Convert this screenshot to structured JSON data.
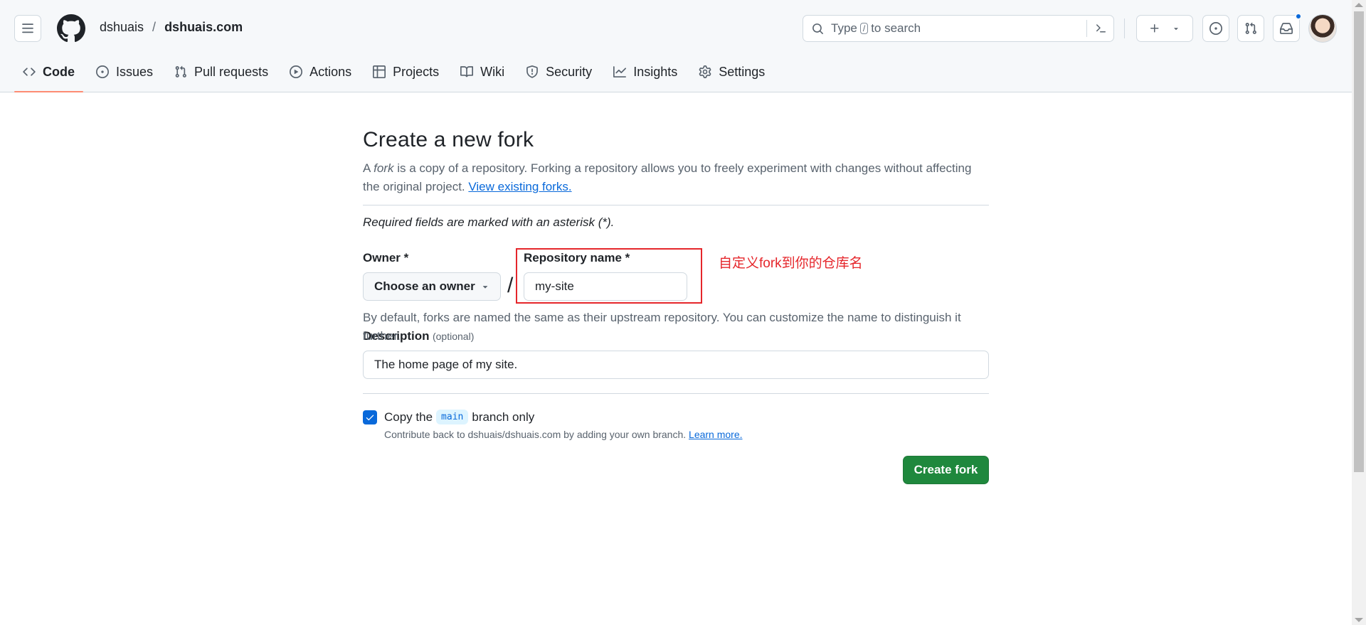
{
  "header": {
    "owner": "dshuais",
    "separator": "/",
    "repo": "dshuais.com",
    "search": {
      "before": "Type",
      "key": "/",
      "after": "to search"
    }
  },
  "tabs": [
    {
      "label": "Code",
      "icon": "code-icon",
      "active": true
    },
    {
      "label": "Issues",
      "icon": "issue-icon"
    },
    {
      "label": "Pull requests",
      "icon": "pull-request-icon"
    },
    {
      "label": "Actions",
      "icon": "play-icon"
    },
    {
      "label": "Projects",
      "icon": "table-icon"
    },
    {
      "label": "Wiki",
      "icon": "book-icon"
    },
    {
      "label": "Security",
      "icon": "shield-icon"
    },
    {
      "label": "Insights",
      "icon": "graph-icon"
    },
    {
      "label": "Settings",
      "icon": "gear-icon"
    }
  ],
  "page": {
    "title": "Create a new fork",
    "intro_a": "A ",
    "intro_fork": "fork",
    "intro_b": " is a copy of a repository. Forking a repository allows you to freely experiment with changes without affecting the original project. ",
    "intro_link": "View existing forks.",
    "required_note": "Required fields are marked with an asterisk (*).",
    "owner_label": "Owner *",
    "owner_value": "Choose an owner",
    "slash": "/",
    "repo_label": "Repository name *",
    "repo_value": "my-site",
    "annotation": "自定义fork到你的仓库名",
    "name_hint": "By default, forks are named the same as their upstream repository. You can customize the name to distinguish it further.",
    "description_label": "Description",
    "description_optional": "(optional)",
    "description_value": "The home page of my site.",
    "copy_before": "Copy the",
    "copy_branch": "main",
    "copy_after": "branch only",
    "copy_checked": true,
    "copy_hint": "Contribute back to dshuais/dshuais.com by adding your own branch.",
    "copy_hint_link": "Learn more.",
    "create_button": "Create fork"
  },
  "colors": {
    "primary": "#1f883d",
    "link": "#0969da",
    "annotation": "#e5262b",
    "tab_underline": "#fd8c73"
  }
}
